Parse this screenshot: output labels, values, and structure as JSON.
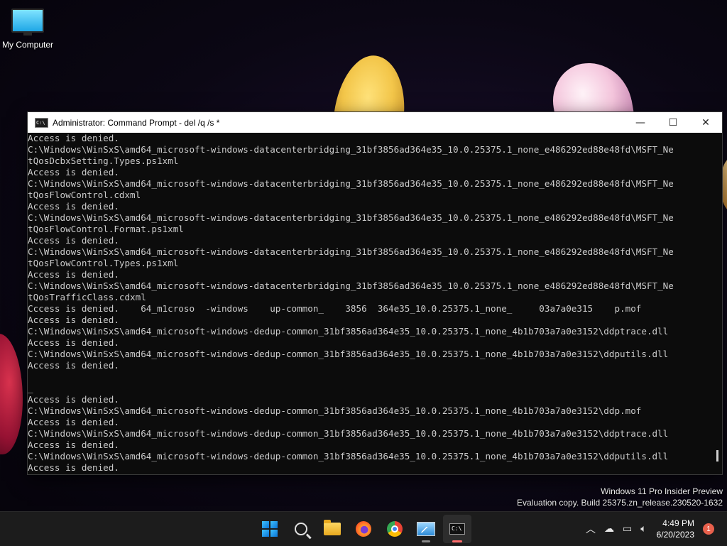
{
  "desktop": {
    "icons": [
      {
        "label": "My Computer",
        "icon": "monitor-icon"
      }
    ]
  },
  "window": {
    "title": "Administrator:  Command Prompt - del  /q /s *",
    "controls": {
      "minimize": "—",
      "maximize": "☐",
      "close": "✕"
    },
    "lines": [
      "Access is denied.",
      "C:\\Windows\\WinSxS\\amd64_microsoft-windows-datacenterbridging_31bf3856ad364e35_10.0.25375.1_none_e486292ed88e48fd\\MSFT_Ne",
      "tQosDcbxSetting.Types.ps1xml",
      "Access is denied.",
      "C:\\Windows\\WinSxS\\amd64_microsoft-windows-datacenterbridging_31bf3856ad364e35_10.0.25375.1_none_e486292ed88e48fd\\MSFT_Ne",
      "tQosFlowControl.cdxml",
      "Access is denied.",
      "C:\\Windows\\WinSxS\\amd64_microsoft-windows-datacenterbridging_31bf3856ad364e35_10.0.25375.1_none_e486292ed88e48fd\\MSFT_Ne",
      "tQosFlowControl.Format.ps1xml",
      "Access is denied.",
      "C:\\Windows\\WinSxS\\amd64_microsoft-windows-datacenterbridging_31bf3856ad364e35_10.0.25375.1_none_e486292ed88e48fd\\MSFT_Ne",
      "tQosFlowControl.Types.ps1xml",
      "Access is denied.",
      "C:\\Windows\\WinSxS\\amd64_microsoft-windows-datacenterbridging_31bf3856ad364e35_10.0.25375.1_none_e486292ed88e48fd\\MSFT_Ne",
      "tQosTrafficClass.cdxml",
      "Cccess is denied.    64_m1croso  -windows    up-common_    3856  364e35_10.0.25375.1_none_     03a7a0e315    p.mof",
      "Access is denied.",
      "C:\\Windows\\WinSxS\\amd64_microsoft-windows-dedup-common_31bf3856ad364e35_10.0.25375.1_none_4b1b703a7a0e3152\\ddptrace.dll",
      "Access is denied.",
      "C:\\Windows\\WinSxS\\amd64_microsoft-windows-dedup-common_31bf3856ad364e35_10.0.25375.1_none_4b1b703a7a0e3152\\ddputils.dll",
      "Access is denied.",
      "",
      "_",
      "Access is denied.",
      "C:\\Windows\\WinSxS\\amd64_microsoft-windows-dedup-common_31bf3856ad364e35_10.0.25375.1_none_4b1b703a7a0e3152\\ddp.mof",
      "Access is denied.",
      "C:\\Windows\\WinSxS\\amd64_microsoft-windows-dedup-common_31bf3856ad364e35_10.0.25375.1_none_4b1b703a7a0e3152\\ddptrace.dll",
      "Access is denied.",
      "C:\\Windows\\WinSxS\\amd64_microsoft-windows-dedup-common_31bf3856ad364e35_10.0.25375.1_none_4b1b703a7a0e3152\\ddputils.dll",
      "Access is denied."
    ]
  },
  "watermark": {
    "line1": "Windows 11 Pro Insider Preview",
    "line2": "Evaluation copy. Build 25375.zn_release.230520-1632"
  },
  "taskbar": {
    "apps": [
      {
        "name": "start",
        "icon": "windows-start-icon"
      },
      {
        "name": "search",
        "icon": "search-icon"
      },
      {
        "name": "file-explorer",
        "icon": "folder-icon"
      },
      {
        "name": "firefox",
        "icon": "firefox-icon"
      },
      {
        "name": "chrome",
        "icon": "chrome-icon"
      },
      {
        "name": "resource-monitor",
        "icon": "monitor-app-icon"
      },
      {
        "name": "command-prompt",
        "icon": "terminal-icon"
      }
    ],
    "tray": {
      "time": "4:49 PM",
      "date": "6/20/2023",
      "notification_count": "1"
    }
  },
  "colors": {
    "console_bg": "#0c0c0c",
    "console_text": "#cccccc",
    "taskbar_bg": "#1c1c1c",
    "notification": "#e8604c"
  }
}
